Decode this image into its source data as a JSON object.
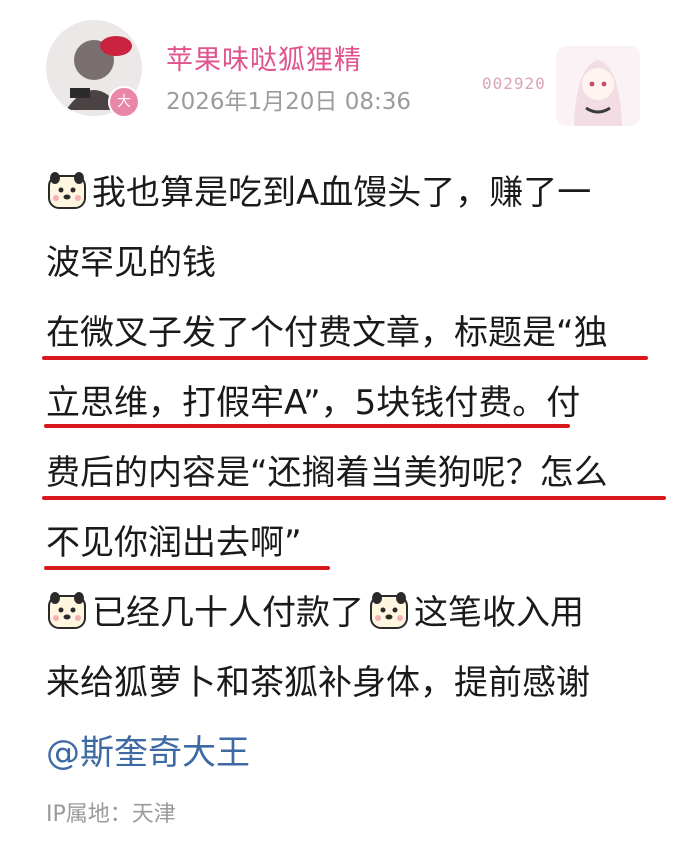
{
  "post": {
    "username": "苹果味哒狐狸精",
    "time": "2026年1月20日 08:36",
    "badge": "大",
    "decoration_text": "002920",
    "accent_color": "#e0538c",
    "underline_color": "#d9181e"
  },
  "content": {
    "line1": "我也算是吃到A血馒头了，赚了一",
    "line2": "波罕见的钱",
    "line3": "在微叉子发了个付费文章，标题是“独",
    "line4": "立思维，打假牢A”，5块钱付费。付",
    "line5": "费后的内容是“还搁着当美狗呢？怎么",
    "line6": "不见你润出去啊”",
    "line7": "已经几十人付款了",
    "line7b": "这笔收入用",
    "line8": "来给狐萝卜和茶狐补身体，提前感谢",
    "mention": "@斯奎奇大王"
  },
  "footer": {
    "ip_label": "IP属地：天津"
  }
}
